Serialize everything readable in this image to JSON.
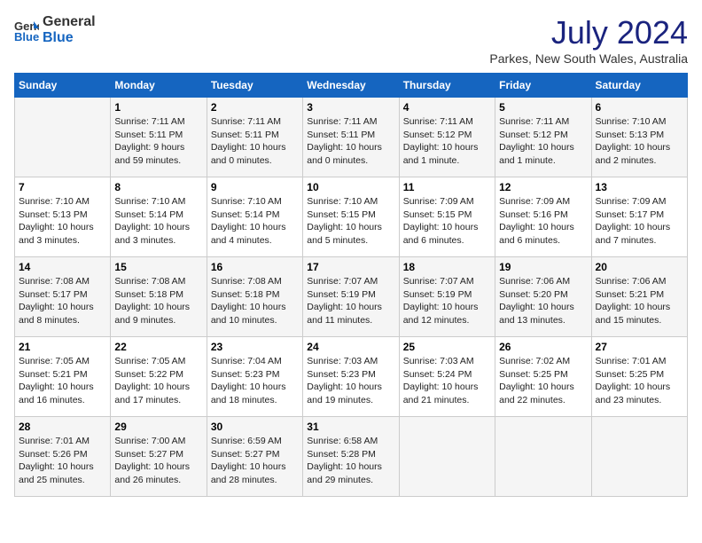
{
  "header": {
    "logo_general": "General",
    "logo_blue": "Blue",
    "title": "July 2024",
    "location": "Parkes, New South Wales, Australia"
  },
  "days_of_week": [
    "Sunday",
    "Monday",
    "Tuesday",
    "Wednesday",
    "Thursday",
    "Friday",
    "Saturday"
  ],
  "weeks": [
    [
      {
        "day": "",
        "info": ""
      },
      {
        "day": "1",
        "info": "Sunrise: 7:11 AM\nSunset: 5:11 PM\nDaylight: 9 hours\nand 59 minutes."
      },
      {
        "day": "2",
        "info": "Sunrise: 7:11 AM\nSunset: 5:11 PM\nDaylight: 10 hours\nand 0 minutes."
      },
      {
        "day": "3",
        "info": "Sunrise: 7:11 AM\nSunset: 5:11 PM\nDaylight: 10 hours\nand 0 minutes."
      },
      {
        "day": "4",
        "info": "Sunrise: 7:11 AM\nSunset: 5:12 PM\nDaylight: 10 hours\nand 1 minute."
      },
      {
        "day": "5",
        "info": "Sunrise: 7:11 AM\nSunset: 5:12 PM\nDaylight: 10 hours\nand 1 minute."
      },
      {
        "day": "6",
        "info": "Sunrise: 7:10 AM\nSunset: 5:13 PM\nDaylight: 10 hours\nand 2 minutes."
      }
    ],
    [
      {
        "day": "7",
        "info": "Sunrise: 7:10 AM\nSunset: 5:13 PM\nDaylight: 10 hours\nand 3 minutes."
      },
      {
        "day": "8",
        "info": "Sunrise: 7:10 AM\nSunset: 5:14 PM\nDaylight: 10 hours\nand 3 minutes."
      },
      {
        "day": "9",
        "info": "Sunrise: 7:10 AM\nSunset: 5:14 PM\nDaylight: 10 hours\nand 4 minutes."
      },
      {
        "day": "10",
        "info": "Sunrise: 7:10 AM\nSunset: 5:15 PM\nDaylight: 10 hours\nand 5 minutes."
      },
      {
        "day": "11",
        "info": "Sunrise: 7:09 AM\nSunset: 5:15 PM\nDaylight: 10 hours\nand 6 minutes."
      },
      {
        "day": "12",
        "info": "Sunrise: 7:09 AM\nSunset: 5:16 PM\nDaylight: 10 hours\nand 6 minutes."
      },
      {
        "day": "13",
        "info": "Sunrise: 7:09 AM\nSunset: 5:17 PM\nDaylight: 10 hours\nand 7 minutes."
      }
    ],
    [
      {
        "day": "14",
        "info": "Sunrise: 7:08 AM\nSunset: 5:17 PM\nDaylight: 10 hours\nand 8 minutes."
      },
      {
        "day": "15",
        "info": "Sunrise: 7:08 AM\nSunset: 5:18 PM\nDaylight: 10 hours\nand 9 minutes."
      },
      {
        "day": "16",
        "info": "Sunrise: 7:08 AM\nSunset: 5:18 PM\nDaylight: 10 hours\nand 10 minutes."
      },
      {
        "day": "17",
        "info": "Sunrise: 7:07 AM\nSunset: 5:19 PM\nDaylight: 10 hours\nand 11 minutes."
      },
      {
        "day": "18",
        "info": "Sunrise: 7:07 AM\nSunset: 5:19 PM\nDaylight: 10 hours\nand 12 minutes."
      },
      {
        "day": "19",
        "info": "Sunrise: 7:06 AM\nSunset: 5:20 PM\nDaylight: 10 hours\nand 13 minutes."
      },
      {
        "day": "20",
        "info": "Sunrise: 7:06 AM\nSunset: 5:21 PM\nDaylight: 10 hours\nand 15 minutes."
      }
    ],
    [
      {
        "day": "21",
        "info": "Sunrise: 7:05 AM\nSunset: 5:21 PM\nDaylight: 10 hours\nand 16 minutes."
      },
      {
        "day": "22",
        "info": "Sunrise: 7:05 AM\nSunset: 5:22 PM\nDaylight: 10 hours\nand 17 minutes."
      },
      {
        "day": "23",
        "info": "Sunrise: 7:04 AM\nSunset: 5:23 PM\nDaylight: 10 hours\nand 18 minutes."
      },
      {
        "day": "24",
        "info": "Sunrise: 7:03 AM\nSunset: 5:23 PM\nDaylight: 10 hours\nand 19 minutes."
      },
      {
        "day": "25",
        "info": "Sunrise: 7:03 AM\nSunset: 5:24 PM\nDaylight: 10 hours\nand 21 minutes."
      },
      {
        "day": "26",
        "info": "Sunrise: 7:02 AM\nSunset: 5:25 PM\nDaylight: 10 hours\nand 22 minutes."
      },
      {
        "day": "27",
        "info": "Sunrise: 7:01 AM\nSunset: 5:25 PM\nDaylight: 10 hours\nand 23 minutes."
      }
    ],
    [
      {
        "day": "28",
        "info": "Sunrise: 7:01 AM\nSunset: 5:26 PM\nDaylight: 10 hours\nand 25 minutes."
      },
      {
        "day": "29",
        "info": "Sunrise: 7:00 AM\nSunset: 5:27 PM\nDaylight: 10 hours\nand 26 minutes."
      },
      {
        "day": "30",
        "info": "Sunrise: 6:59 AM\nSunset: 5:27 PM\nDaylight: 10 hours\nand 28 minutes."
      },
      {
        "day": "31",
        "info": "Sunrise: 6:58 AM\nSunset: 5:28 PM\nDaylight: 10 hours\nand 29 minutes."
      },
      {
        "day": "",
        "info": ""
      },
      {
        "day": "",
        "info": ""
      },
      {
        "day": "",
        "info": ""
      }
    ]
  ]
}
